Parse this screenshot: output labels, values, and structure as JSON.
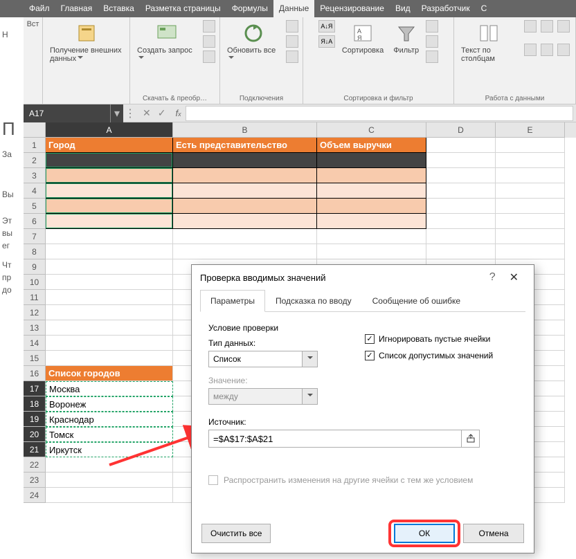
{
  "tabs": [
    "Файл",
    "Главная",
    "Вставка",
    "Разметка страницы",
    "Формулы",
    "Данные",
    "Рецензирование",
    "Вид",
    "Разработчик",
    "С"
  ],
  "activeTab": "Данные",
  "ribbon": {
    "g0": {
      "btn": "Вст"
    },
    "g1": {
      "btn": "Получение внешних данных",
      "label": ""
    },
    "g2": {
      "btn": "Создать запрос",
      "label": "Скачать & преобр…"
    },
    "g3": {
      "btn": "Обновить все",
      "label": "Подключения"
    },
    "g4": {
      "sort_az": "А↓Я",
      "sort_za": "Я↓А",
      "sort": "Сортировка",
      "filter": "Фильтр",
      "label": "Сортировка и фильтр"
    },
    "g5": {
      "btn": "Текст по столбцам",
      "label": "Работа с данными"
    }
  },
  "nameBox": "A17",
  "colHeaders": [
    "A",
    "B",
    "C",
    "D",
    "E"
  ],
  "table": {
    "r1": {
      "A": "Город",
      "B": "Есть представительство",
      "C": "Объем выручки"
    },
    "r16": {
      "A": "Список городов"
    },
    "r17": {
      "A": "Москва"
    },
    "r18": {
      "A": "Воронеж"
    },
    "r19": {
      "A": "Краснодар"
    },
    "r20": {
      "A": "Томск"
    },
    "r21": {
      "A": "Иркутск"
    }
  },
  "dialog": {
    "title": "Проверка вводимых значений",
    "tabs": [
      "Параметры",
      "Подсказка по вводу",
      "Сообщение об ошибке"
    ],
    "groupTitle": "Условие проверки",
    "typeLabel": "Тип данных:",
    "typeValue": "Список",
    "valueLabel": "Значение:",
    "valueValue": "между",
    "chk1": "Игнорировать пустые ячейки",
    "chk2": "Список допустимых значений",
    "sourceLabel": "Источник:",
    "sourceValue": "=$A$17:$A$21",
    "propagate": "Распространить изменения на другие ячейки с тем же условием",
    "clear": "Очистить все",
    "ok": "ОК",
    "cancel": "Отмена"
  },
  "leftStrip": {
    "a": "Н",
    "b": "П",
    "c": "За",
    "d": "Вы",
    "e": "Эт",
    "f": "вы",
    "g": "ег",
    "h": "Чт",
    "i": "пр",
    "j": "до"
  }
}
